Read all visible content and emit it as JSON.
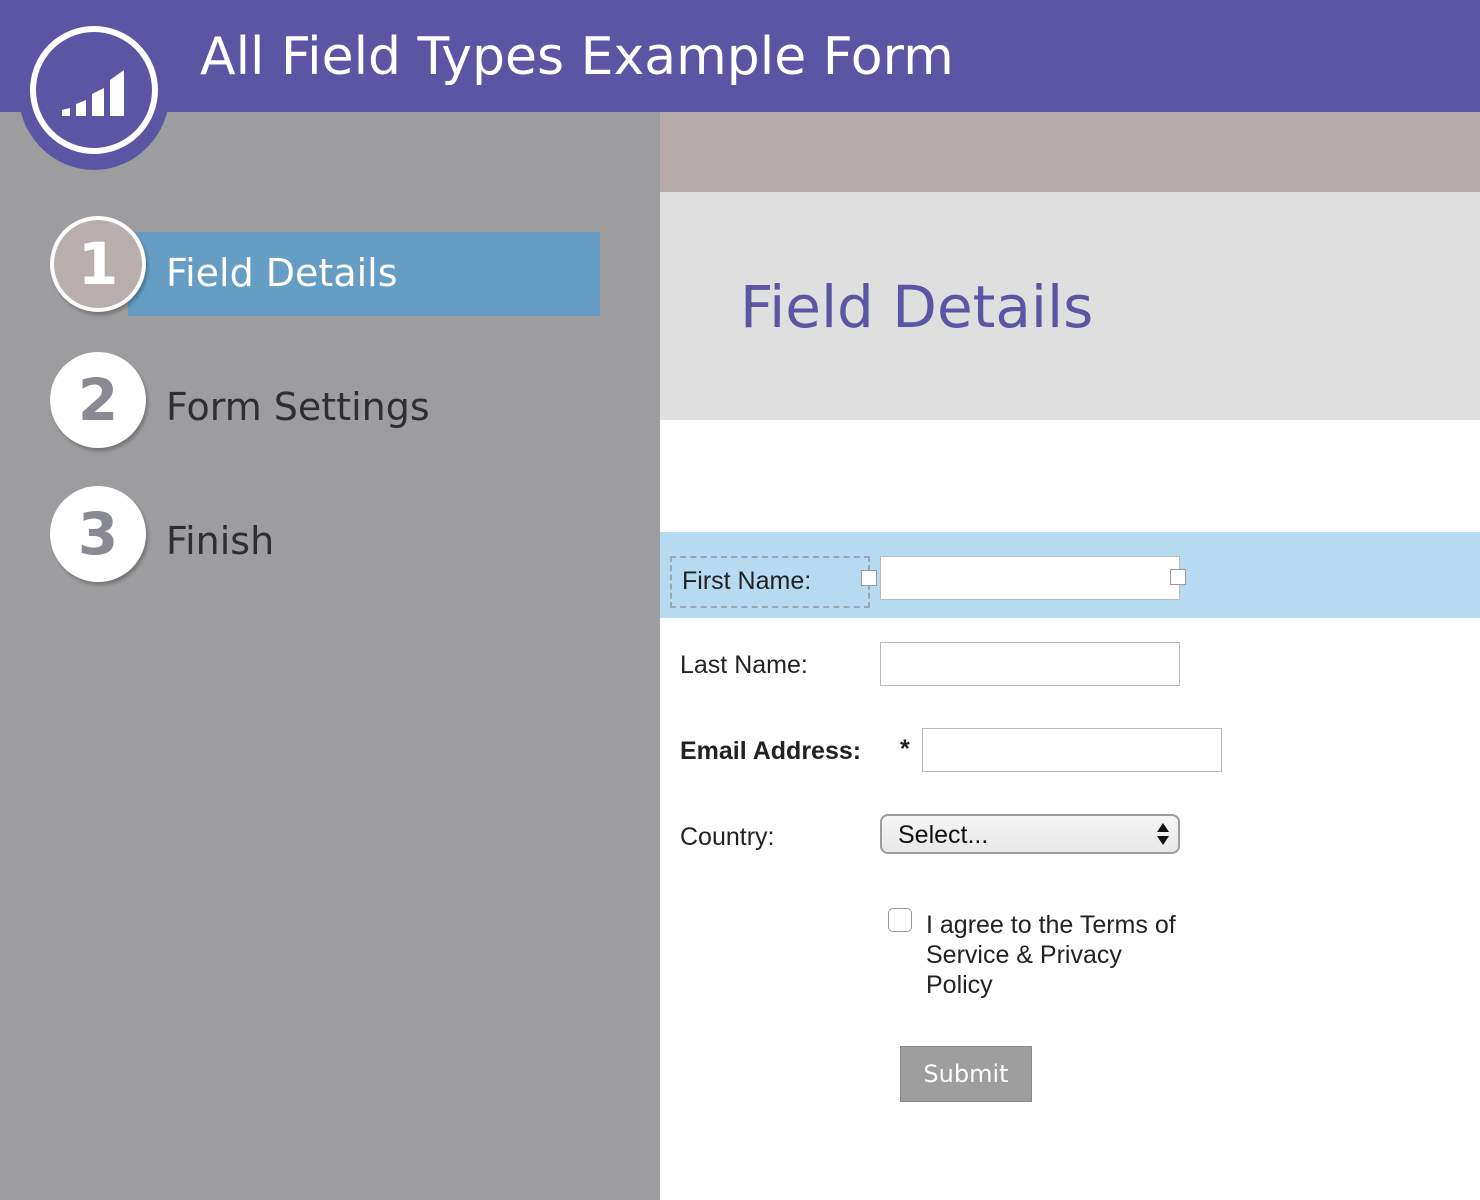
{
  "app": {
    "title": "All Field Types Example Form",
    "logo_icon": "marketo-bars-icon"
  },
  "colors": {
    "brand": "#5b55a3",
    "sidebar": "#9d9d9f",
    "active_step": "#659dc4",
    "highlight_row": "#b6daf0"
  },
  "steps": [
    {
      "number": "1",
      "label": "Field Details",
      "active": true
    },
    {
      "number": "2",
      "label": "Form Settings",
      "active": false
    },
    {
      "number": "3",
      "label": "Finish",
      "active": false
    }
  ],
  "page": {
    "title": "Field Details"
  },
  "form": {
    "first_name": {
      "label": "First Name:",
      "value": ""
    },
    "last_name": {
      "label": "Last Name:",
      "value": ""
    },
    "email": {
      "label": "Email Address:",
      "required_mark": "*",
      "value": ""
    },
    "country": {
      "label": "Country:",
      "selected": "Select..."
    },
    "consent": {
      "label": "I agree to the Terms of Service & Privacy Policy",
      "checked": false
    },
    "submit_label": "Submit"
  }
}
